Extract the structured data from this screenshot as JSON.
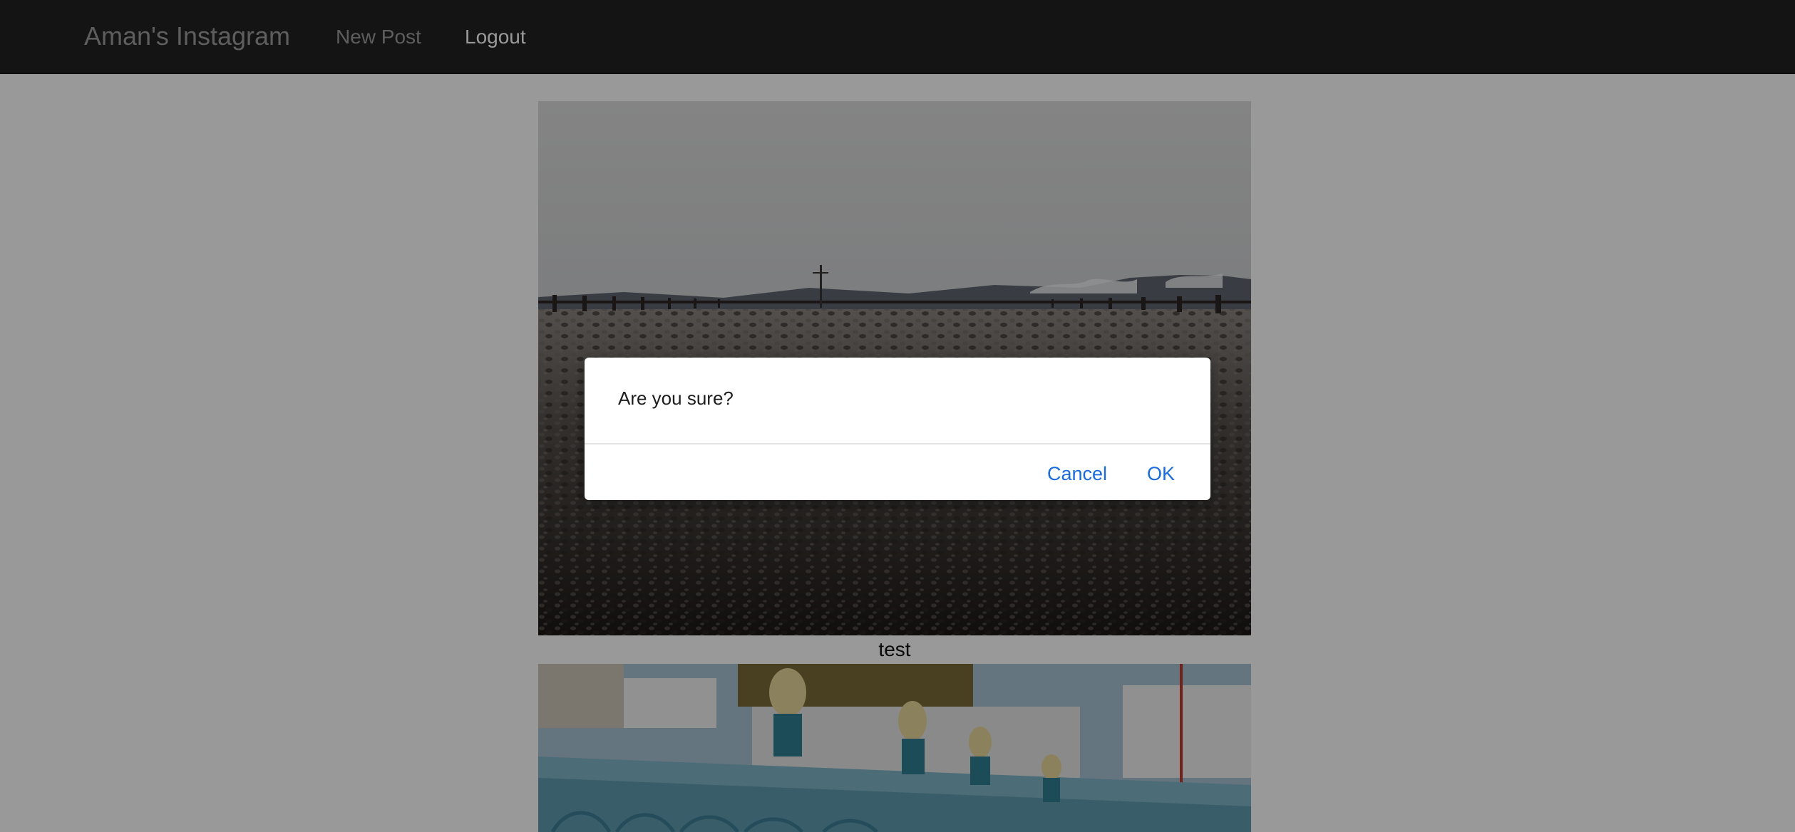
{
  "navbar": {
    "brand": "Aman's Instagram",
    "new_post": "New Post",
    "logout": "Logout"
  },
  "feed": {
    "posts": [
      {
        "caption": "test"
      }
    ]
  },
  "dialog": {
    "message": "Are you sure?",
    "cancel_label": "Cancel",
    "ok_label": "OK"
  },
  "colors": {
    "navbar_bg": "#222222",
    "brand_text": "#9d9d9d",
    "active_link": "#ffffff",
    "dialog_button": "#1a6bdc",
    "overlay": "rgba(0,0,0,0.40)"
  }
}
